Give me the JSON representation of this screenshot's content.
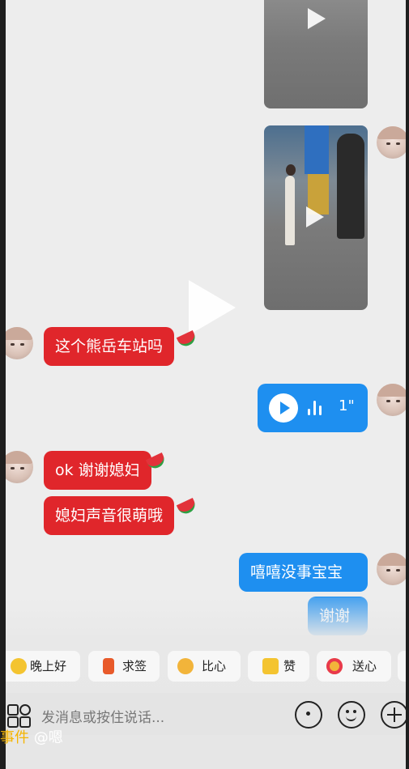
{
  "messages": [
    {
      "side": "left",
      "text": "这个熊岳车站吗",
      "color": "red"
    },
    {
      "side": "right",
      "type": "voice",
      "duration": "1\""
    },
    {
      "side": "left",
      "text": "ok 谢谢媳妇",
      "color": "red"
    },
    {
      "side": "left",
      "text": "媳妇声音很萌哦",
      "color": "red"
    },
    {
      "side": "right",
      "text": "嘻嘻没事宝宝",
      "color": "blue"
    },
    {
      "side": "right",
      "text": "谢谢",
      "color": "blue"
    }
  ],
  "quick_replies": [
    "晚上好",
    "求签",
    "比心",
    "赞",
    "送心"
  ],
  "input": {
    "placeholder": "发消息或按住说话..."
  },
  "caption": {
    "prefix": "事件",
    "text": "@嗯"
  },
  "colors": {
    "red_bubble": "#e0262b",
    "blue_bubble": "#1e8ff0",
    "background": "#ededed"
  }
}
